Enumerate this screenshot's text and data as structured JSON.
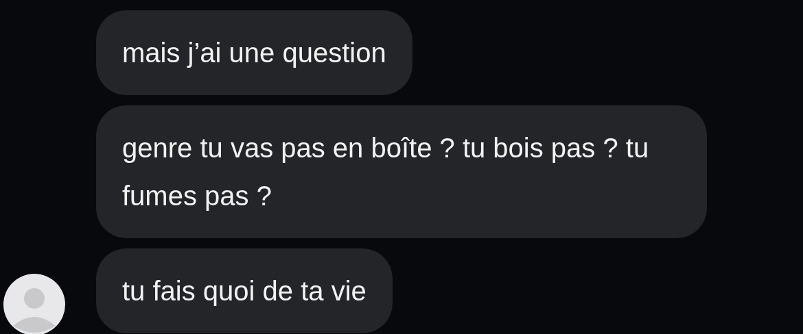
{
  "messages": [
    {
      "text": "mais j’ai une question"
    },
    {
      "text": "genre tu vas pas en boîte ? tu bois pas ? tu fumes pas ?"
    },
    {
      "text": "tu fais quoi de ta vie"
    }
  ]
}
